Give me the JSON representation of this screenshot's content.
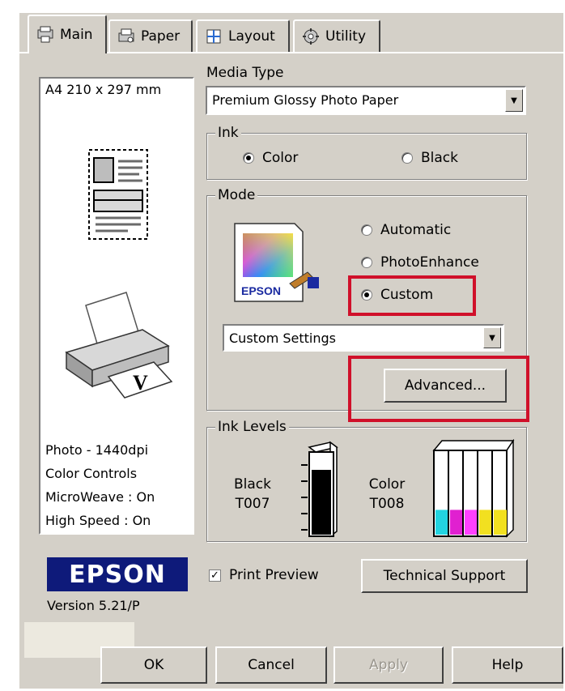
{
  "tabs": [
    {
      "label": "Main",
      "icon": "main-tab-icon"
    },
    {
      "label": "Paper",
      "icon": "paper-tab-icon"
    },
    {
      "label": "Layout",
      "icon": "layout-tab-icon"
    },
    {
      "label": "Utility",
      "icon": "utility-tab-icon"
    }
  ],
  "preview": {
    "paper_size": "A4 210 x 297 mm",
    "info": [
      "Photo - 1440dpi",
      "Color Controls",
      "MicroWeave : On",
      "High Speed : On"
    ]
  },
  "media_type": {
    "label": "Media Type",
    "value": "Premium Glossy Photo Paper"
  },
  "ink": {
    "legend": "Ink",
    "color_label": "Color",
    "black_label": "Black",
    "selected": "Color"
  },
  "mode": {
    "legend": "Mode",
    "automatic_label": "Automatic",
    "photoenhance_label": "PhotoEnhance",
    "custom_label": "Custom",
    "selected": "Custom",
    "custom_settings_value": "Custom Settings",
    "advanced_label": "Advanced...",
    "icon_text": "EPSON"
  },
  "ink_levels": {
    "legend": "Ink Levels",
    "black_name": "Black",
    "black_code": "T007",
    "color_name": "Color",
    "color_code": "T008",
    "black_level": 0.8,
    "color_levels": [
      0.3,
      0.3,
      0.3,
      0.3,
      0.3
    ]
  },
  "footer": {
    "brand": "EPSON",
    "version": "Version 5.21/P",
    "print_preview_label": "Print Preview",
    "print_preview_checked": true,
    "technical_support_label": "Technical Support",
    "ok_label": "OK",
    "cancel_label": "Cancel",
    "apply_label": "Apply",
    "help_label": "Help"
  },
  "colors": {
    "highlight_box": "#d0102a",
    "brand_blue": "#0e1a7a"
  }
}
